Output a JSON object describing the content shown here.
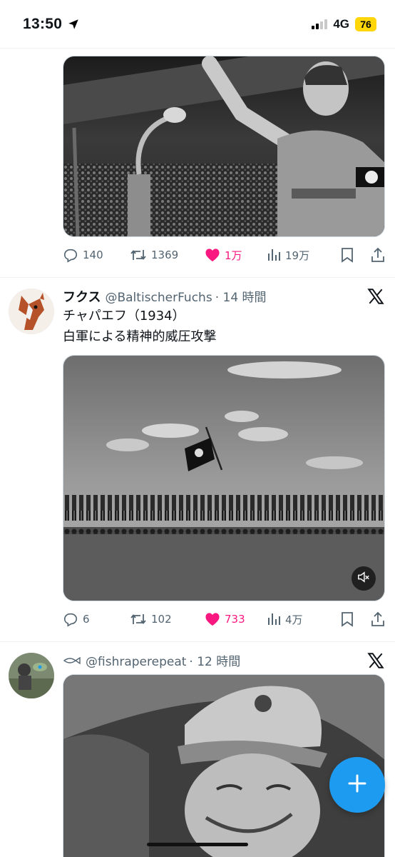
{
  "status_bar": {
    "time": "13:50",
    "network": "4G",
    "battery": "76"
  },
  "posts": [
    {
      "media_alt": "photo",
      "actions": {
        "replies": "140",
        "reposts": "1369",
        "likes": "1万",
        "views": "19万"
      }
    },
    {
      "display_name": "フクス",
      "handle": "@BaltischerFuchs",
      "time": "· 14 時間",
      "text_line1": "チャパエフ（1934）",
      "text_line2": "白軍による精神的威圧攻撃",
      "actions": {
        "replies": "6",
        "reposts": "102",
        "likes": "733",
        "views": "4万"
      }
    },
    {
      "display_name": "",
      "handle": "@fishraperepeat",
      "time": "· 12 時間"
    }
  ],
  "colors": {
    "like_pink": "#f91880",
    "accent_blue": "#1d9bf0",
    "muted_gray": "#536471",
    "battery_yellow": "#ffd60a"
  },
  "icons": [
    "location-arrow-icon",
    "signal-icon",
    "reply-icon",
    "repost-icon",
    "heart-filled-icon",
    "views-icon",
    "bookmark-icon",
    "share-icon",
    "x-logo-icon",
    "mute-icon",
    "plus-icon",
    "fish-icon"
  ]
}
